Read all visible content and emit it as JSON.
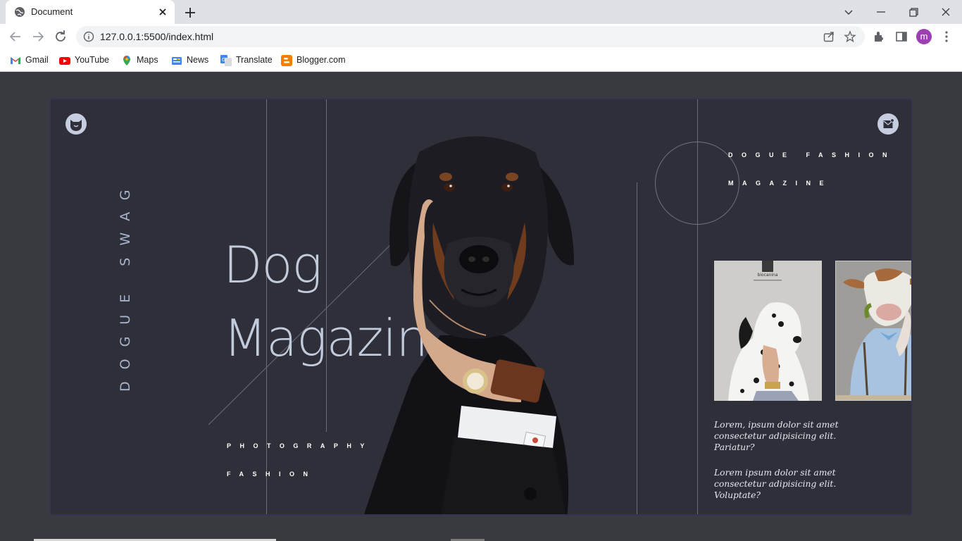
{
  "browser": {
    "tab_title": "Document",
    "url": "127.0.0.1:5500/index.html",
    "profile_initial": "m",
    "bookmarks": [
      {
        "label": "Gmail",
        "icon": "gmail-icon"
      },
      {
        "label": "YouTube",
        "icon": "youtube-icon"
      },
      {
        "label": "Maps",
        "icon": "maps-icon"
      },
      {
        "label": "News",
        "icon": "news-icon"
      },
      {
        "label": "Translate",
        "icon": "translate-icon"
      },
      {
        "label": "Blogger.com",
        "icon": "blogger-icon"
      }
    ]
  },
  "page": {
    "vertical_brand": "DOGUE SWAG",
    "title_line1": "Dog",
    "title_line2": "Magazin",
    "tag_photography": "PHOTOGRAPHY",
    "tag_fashion": "FASHION",
    "mag_title_line1": "DOGUE FASHION",
    "mag_title_line2": "MAGAZINE",
    "thumb1_brand": "biocanina",
    "paragraphs": [
      "Lorem, ipsum dolor sit amet consectetur adipisicing elit. Pariatur?",
      "Lorem ipsum dolor sit amet consectetur adipisicing elit. Voluptate?"
    ]
  },
  "colors": {
    "page_bg": "#393a40",
    "card_bg": "#2e2f38",
    "title_color": "#c2cbdc",
    "accent_badge": "#c7cde0"
  }
}
